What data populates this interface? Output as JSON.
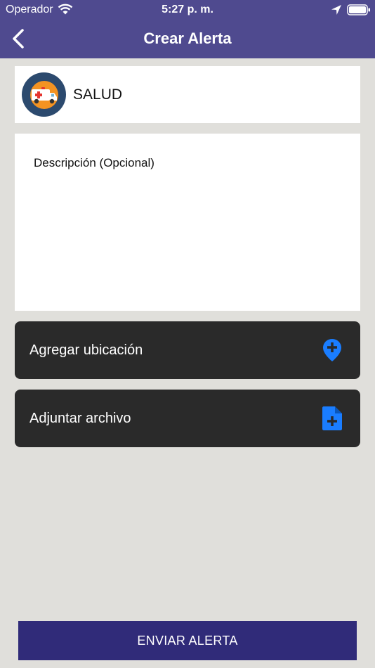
{
  "status_bar": {
    "carrier": "Operador",
    "time": "5:27 p. m."
  },
  "nav": {
    "title": "Crear Alerta",
    "back_icon": "chevron-left-icon"
  },
  "category": {
    "label": "SALUD",
    "icon": "ambulance-icon",
    "avatar_color": "#2c4a6e"
  },
  "description": {
    "placeholder": "Descripción (Opcional)",
    "value": ""
  },
  "actions": [
    {
      "label": "Agregar ubicación",
      "icon": "location-plus-icon"
    },
    {
      "label": "Adjuntar archivo",
      "icon": "file-plus-icon"
    }
  ],
  "submit": {
    "label": "ENVIAR ALERTA"
  },
  "colors": {
    "header": "#4f4a8f",
    "background": "#e0dfdb",
    "action_row": "#2a2a2a",
    "action_icon": "#1a7dff",
    "submit": "#302b79"
  }
}
